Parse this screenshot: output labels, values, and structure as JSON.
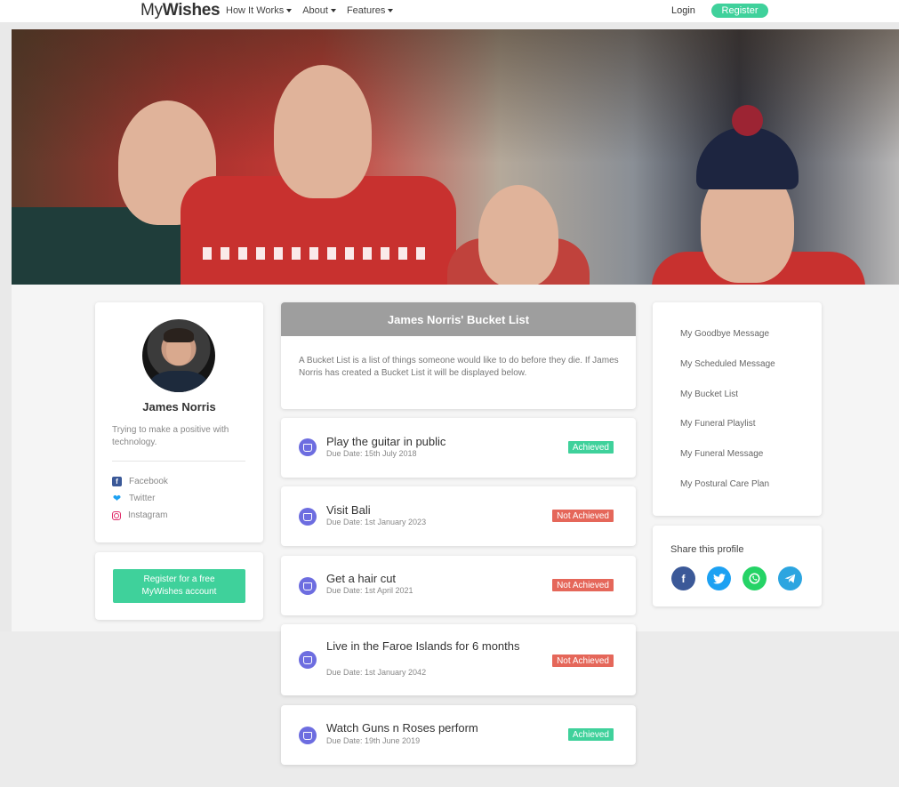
{
  "nav": {
    "logo_light": "My",
    "logo_bold": "Wishes",
    "menu": [
      {
        "label": "How It Works"
      },
      {
        "label": "About"
      },
      {
        "label": "Features"
      }
    ],
    "login": "Login",
    "register": "Register"
  },
  "profile": {
    "name": "James Norris",
    "bio": "Trying to make a positive with technology.",
    "socials": [
      {
        "label": "Facebook",
        "icon": "facebook-icon"
      },
      {
        "label": "Twitter",
        "icon": "twitter-icon"
      },
      {
        "label": "Instagram",
        "icon": "instagram-icon"
      }
    ],
    "cta": "Register for a free MyWishes account"
  },
  "bucket_list": {
    "title": "James Norris' Bucket List",
    "intro": "A Bucket List is a list of things someone would like to do before they die. If James Norris has created a Bucket List it will be displayed below.",
    "items": [
      {
        "title": "Play the guitar in public",
        "due": "Due Date: 15th July 2018",
        "status": "Achieved"
      },
      {
        "title": "Visit Bali",
        "due": "Due Date: 1st January 2023",
        "status": "Not Achieved"
      },
      {
        "title": "Get a hair cut",
        "due": "Due Date: 1st April 2021",
        "status": "Not Achieved"
      },
      {
        "title": "Live in the Faroe Islands for 6 months",
        "due": "Due Date: 1st January 2042",
        "status": "Not Achieved"
      },
      {
        "title": "Watch Guns n Roses perform",
        "due": "Due Date: 19th June 2019",
        "status": "Achieved"
      }
    ]
  },
  "side_menu": [
    "My Goodbye Message",
    "My Scheduled Message",
    "My Bucket List",
    "My Funeral Playlist",
    "My Funeral Message",
    "My Postural Care Plan"
  ],
  "share": {
    "title": "Share this profile",
    "icons": [
      {
        "name": "facebook-icon",
        "color": "#3b5998"
      },
      {
        "name": "twitter-icon",
        "color": "#1da1f2"
      },
      {
        "name": "whatsapp-icon",
        "color": "#25d366"
      },
      {
        "name": "telegram-icon",
        "color": "#2ca5e0"
      }
    ]
  },
  "colors": {
    "accent": "#3fd19b",
    "not_achieved": "#e5675a",
    "wish_icon": "#6d6de0"
  }
}
